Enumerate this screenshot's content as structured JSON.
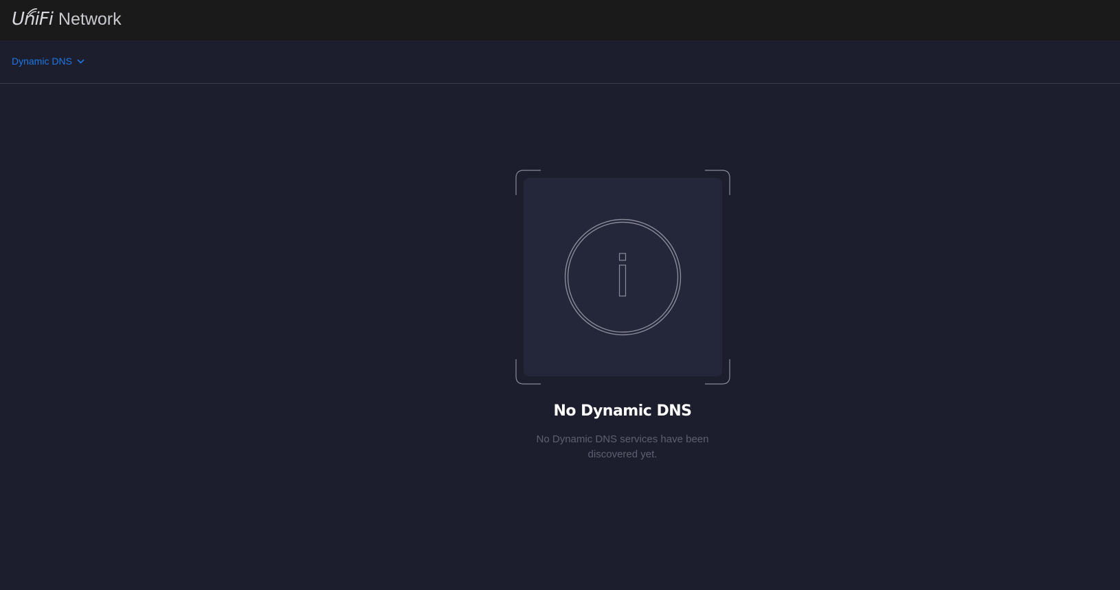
{
  "header": {
    "logo_brand": "UniFi",
    "logo_app": "Network"
  },
  "subnav": {
    "dropdown_label": "Dynamic DNS"
  },
  "empty_state": {
    "icon": "info-icon",
    "title": "No Dynamic DNS",
    "description": "No Dynamic DNS services have been discovered yet."
  },
  "colors": {
    "topbar": "#1a1a1a",
    "background": "#1c1e2d",
    "accent": "#1e78e6",
    "muted_text": "#5d6072"
  }
}
